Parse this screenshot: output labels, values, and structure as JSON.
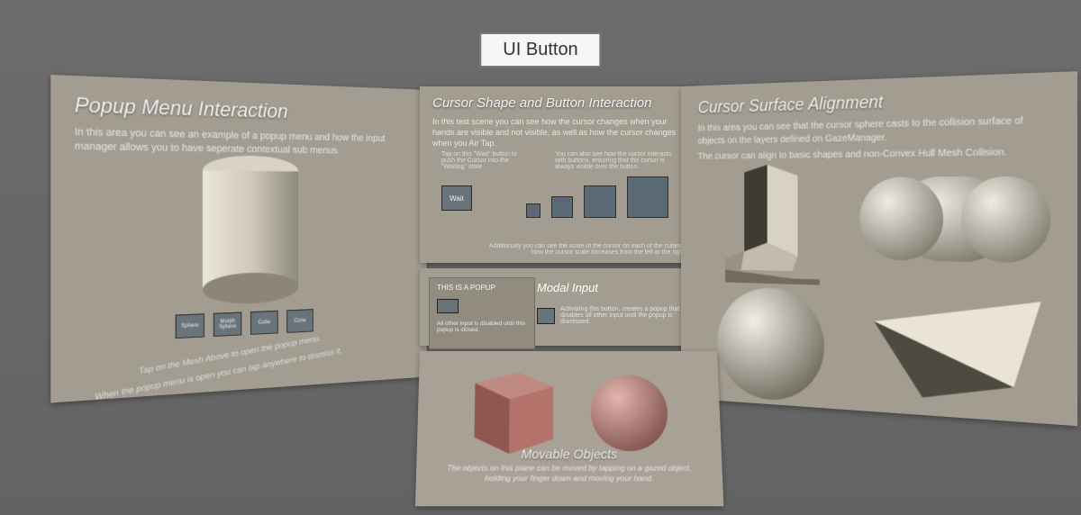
{
  "ui_button_label": "UI Button",
  "panels": {
    "left": {
      "title": "Popup Menu Interaction",
      "body": "In this area you can see an example of a popup menu and how the input manager allows you to have seperate contextual sub menus.",
      "mini_buttons": [
        "Sphere",
        "Morph Sphere",
        "Cube",
        "Cone"
      ],
      "instruction1": "Tap on the Mesh Above to open the popup menu.",
      "instruction2": "When the popup menu is open you can tap anywhere to dismiss it."
    },
    "mid_upper": {
      "title": "Cursor Shape and Button Interaction",
      "body": "In this test scene you can see how the cursor changes when your hands are visible and not visible, as well as how the cursor changes when you Air Tap.",
      "tip_left": "Tap on this \"Wait\" button to push the Cursor into the \"Waiting\" state.",
      "tip_right": "You can also see how the cursor interacts with buttons, ensuring that the cursor is always visible over the button.",
      "wait_label": "Wait",
      "footnote": "Additionally you can see the scale of the cursor on each of the cubes – how the cursor scale increases from the left to the right."
    },
    "mid_lower": {
      "popup_title": "THIS IS A POPUP",
      "popup_note": "All other input is disabled until this popup is closed.",
      "modal_title": "Modal Input",
      "modal_note": "Activating this button, creates a popup that disables all other input until the popup is dismissed."
    },
    "right": {
      "title": "Cursor Surface Alignment",
      "body1": "In this area you can see that the cursor sphere casts to the collision surface of objects on the layers defined on GazeManager.",
      "body2": "The cursor can align to basic shapes and non-Convex Hull Mesh Collision."
    },
    "floor": {
      "title": "Movable Objects",
      "body": "The objects on this plane can be moved by tapping on a gazed object, holding your finger down and moving your hand."
    }
  },
  "colors": {
    "panel_bg": "#a39c90",
    "button_bg": "#69737a",
    "cube_red": "#b47068",
    "sphere_red": "#b97f77"
  }
}
